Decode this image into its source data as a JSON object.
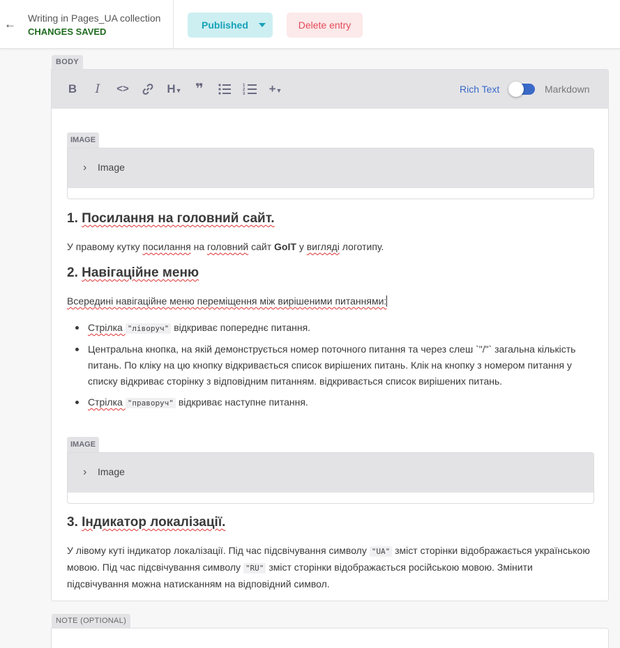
{
  "header": {
    "back_icon": "arrow-left-icon",
    "collection_title": "Writing in Pages_UA collection",
    "save_status": "CHANGES SAVED",
    "status_button": "Published",
    "delete_button": "Delete entry"
  },
  "body_field": {
    "label": "BODY",
    "toolbar": {
      "bold": "B",
      "italic": "I",
      "code": "<>",
      "heading": "H",
      "quote": "❞",
      "mode_rich": "Rich Text",
      "mode_markdown": "Markdown",
      "rich_text_enabled": true
    },
    "image_blocks": [
      {
        "tag": "IMAGE",
        "label": "Image"
      },
      {
        "tag": "IMAGE",
        "label": "Image"
      }
    ],
    "sections": {
      "s1_heading_num": "1.",
      "s1_heading": "Посилання на головний сайт.",
      "s1_text_pre": "У правому кутку ",
      "s1_text_w1": "посилання",
      "s1_text_mid": " на ",
      "s1_text_w2": "головний",
      "s1_text_mid2": " сайт ",
      "s1_text_bold": "GoIT",
      "s1_text_mid3": " у ",
      "s1_text_w3": "вигляді",
      "s1_text_end": " логотипу.",
      "s2_heading_num": "2.",
      "s2_heading": "Навігаційне меню",
      "s2_text": "Всередині навігаційне меню переміщення між вирішеними питаннями:",
      "s2_bullet1_pre": "Стрілка ",
      "s2_bullet1_code": "\"ліворуч\"",
      "s2_bullet1_post": " відкриває попереднє питання.",
      "s2_bullet2": "Центральна кнопка, на якій демонструється номер поточного питання та через слеш `\"/\"` загальна кількість питань. По кліку на цю кнопку відкривається список вирішених питань. Клік на кнопку з номером питання у списку відкриває сторінку з відповідним питанням. відкривається список вирішених питань.",
      "s2_bullet3_pre": "Стрілка ",
      "s2_bullet3_code": "\"праворуч\"",
      "s2_bullet3_post": " відкриває наступне питання.",
      "s3_heading_num": "3.",
      "s3_heading": "Індикатор локалізації.",
      "s3_text_a": "У лівому куті індикатор локалізації. Під час підсвічування символу ",
      "s3_code_ua": "\"UA\"",
      "s3_text_b": " зміст сторінки відображається українською мовою. Під час підсвічування символу ",
      "s3_code_ru": "\"RU\"",
      "s3_text_c": " зміст сторінки відображається російською мовою. Змінити підсвічування можна натисканням на відповідний символ."
    }
  },
  "note_field": {
    "label": "NOTE (OPTIONAL)",
    "value": ""
  }
}
